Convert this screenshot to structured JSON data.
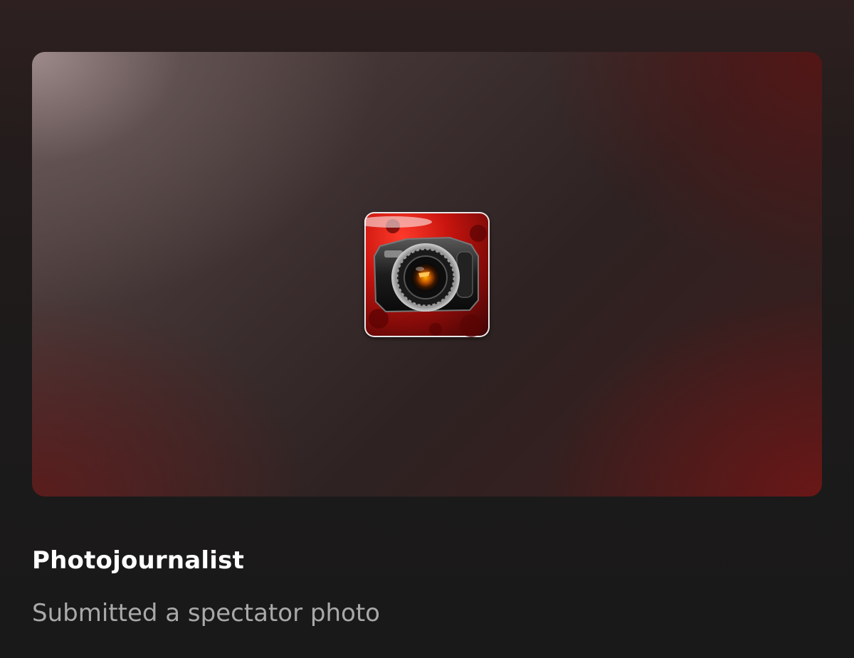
{
  "achievement": {
    "title": "Photojournalist",
    "description": "Submitted a spectator photo",
    "icon": "camera-badge-icon"
  },
  "colors": {
    "background": "#1a1919",
    "title": "#ffffff",
    "description": "#a9a9a9",
    "badge_red": "#c8140e"
  }
}
